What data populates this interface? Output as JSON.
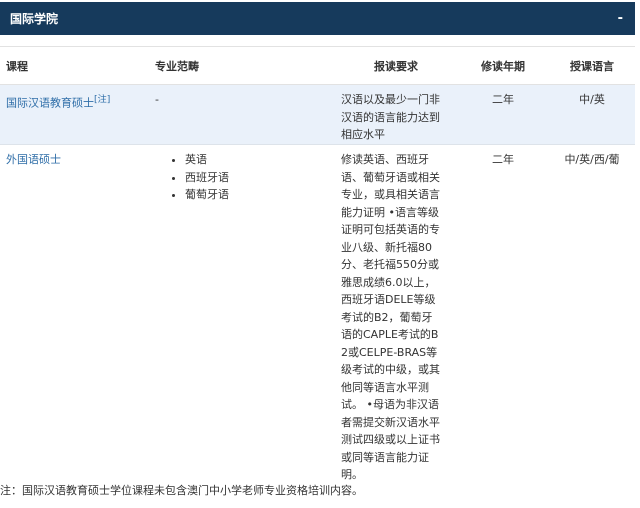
{
  "header": {
    "title": "国际学院",
    "collapse": "-"
  },
  "table": {
    "headers": [
      "课程",
      "专业范畴",
      "报读要求",
      "修读年期",
      "授课语言"
    ],
    "rows": [
      {
        "course": "国际汉语教育硕士",
        "note_mark": "[注]",
        "scope": "-",
        "scope_items": [],
        "requirement": "汉语以及最少一门非汉语的语言能力达到相应水平",
        "years": "二年",
        "language": "中/英"
      },
      {
        "course": "外国语硕士",
        "note_mark": "",
        "scope": "",
        "scope_items": [
          "英语",
          "西班牙语",
          "葡萄牙语"
        ],
        "requirement": "修读英语、西班牙语、葡萄牙语或相关专业，或具相关语言能力证明 •语言等级证明可包括英语的专业八级、新托福80分、老托福550分或雅思成绩6.0以上，西班牙语DELE等级考试的B2，葡萄牙语的CAPLE考试的B2或CELPE-BRAS等级考试的中级，或其他同等语言水平测试。 •母语为非汉语者需提交新汉语水平测试四级或以上证书或同等语言能力证明。",
        "years": "二年",
        "language": "中/英/西/葡"
      }
    ]
  },
  "footnote": "注：国际汉语教育硕士学位课程未包含澳门中小学老师专业资格培训内容。"
}
